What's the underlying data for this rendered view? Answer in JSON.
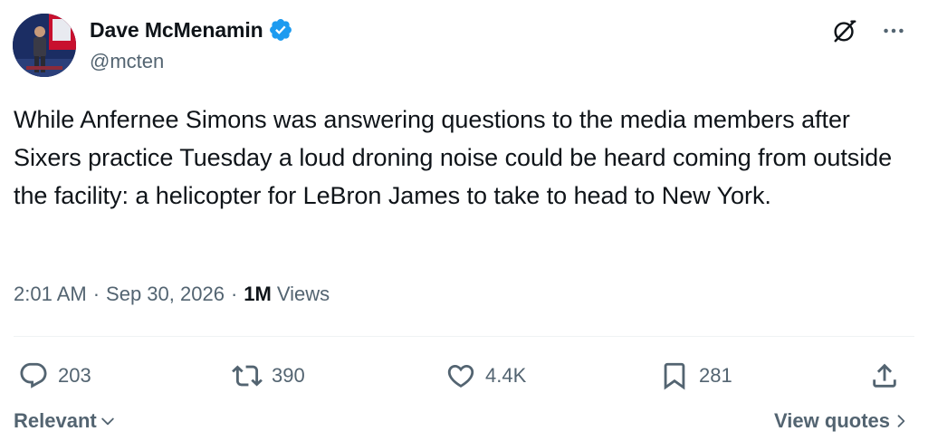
{
  "author": {
    "display_name": "Dave McMenamin",
    "handle": "@mcten",
    "verified_color": "#1d9bf0",
    "avatar": "avatar-photo"
  },
  "tweet": {
    "text": "While Anfernee Simons was answering questions to the media members after Sixers practice Tuesday a loud droning noise could be heard coming from outside the facility: a helicopter for LeBron James to take to head to New York."
  },
  "meta": {
    "time": "2:01 AM",
    "separator": "·",
    "date": "Sep 30, 2026",
    "views_count": "1M",
    "views_label": "Views"
  },
  "actions": {
    "replies": "203",
    "reposts": "390",
    "likes": "4.4K",
    "bookmarks": "281"
  },
  "footer": {
    "sort_label": "Relevant",
    "view_quotes_label": "View quotes"
  },
  "icons": {
    "grok": "grok-icon",
    "more": "more-icon",
    "reply": "reply-icon",
    "repost": "repost-icon",
    "like": "heart-icon",
    "bookmark": "bookmark-icon",
    "share": "share-icon"
  },
  "colors": {
    "text_primary": "#0f1419",
    "text_secondary": "#536471",
    "divider": "#eff3f4"
  }
}
